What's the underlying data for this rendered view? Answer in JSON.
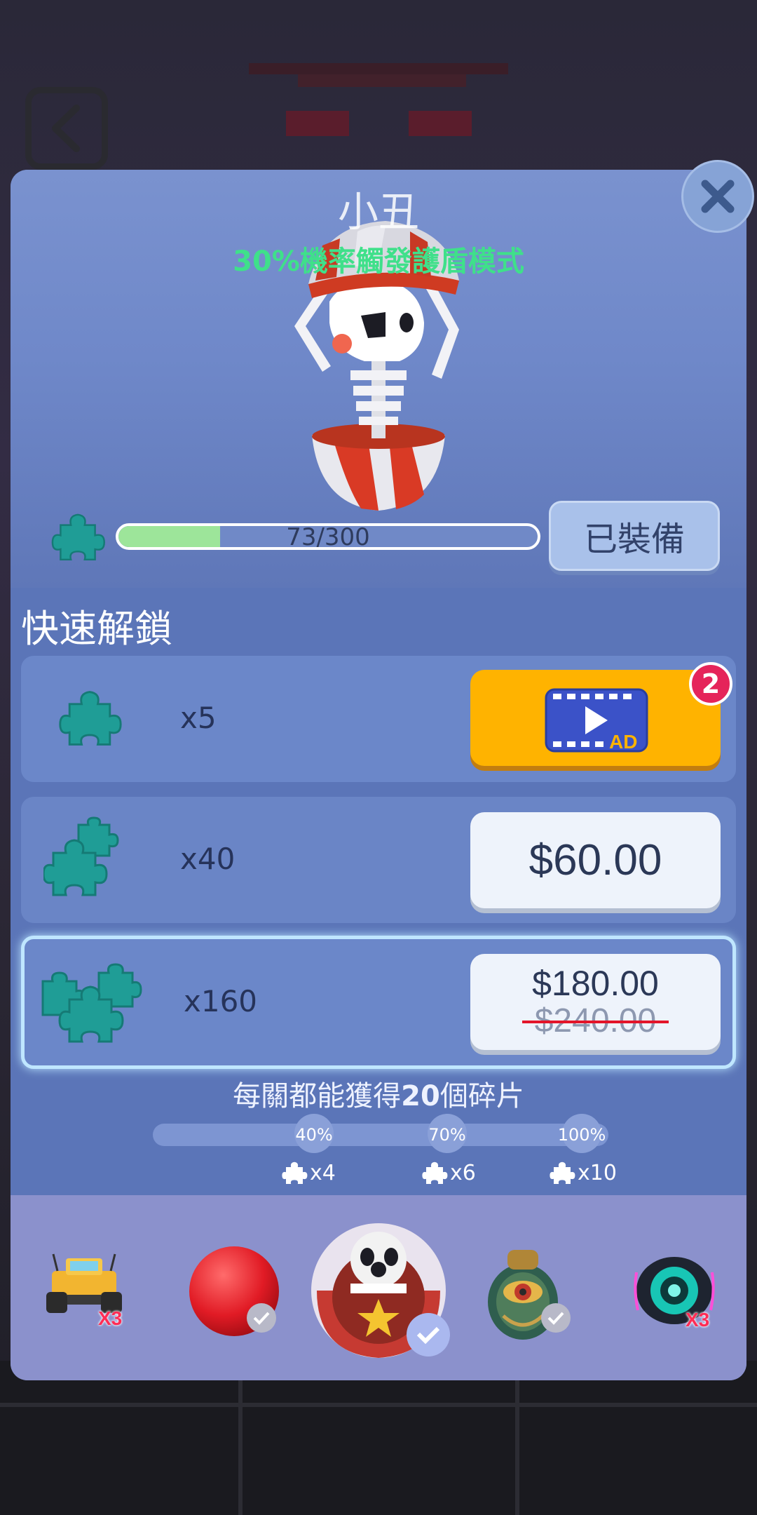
{
  "item": {
    "name": "小丑",
    "description": "30%機率觸發護盾模式"
  },
  "progress": {
    "current": 73,
    "total": 300,
    "text": "73/300",
    "fraction": 0.243
  },
  "equip_button": "已裝備",
  "quick_unlock": {
    "title": "快速解鎖",
    "offers": [
      {
        "quantity": "x5",
        "action": "ad",
        "ad_label": "AD",
        "badge": "2"
      },
      {
        "quantity": "x40",
        "price": "$60.00"
      },
      {
        "quantity": "x160",
        "price": "$180.00",
        "old_price": "$240.00"
      }
    ]
  },
  "level_info": {
    "prefix": "每關都能獲得",
    "count": "20",
    "suffix": "個碎片"
  },
  "milestones": [
    {
      "percent": "40%",
      "reward": "x4"
    },
    {
      "percent": "70%",
      "reward": "x6"
    },
    {
      "percent": "100%",
      "reward": "x10"
    }
  ],
  "skins": [
    {
      "name": "monster-truck",
      "tag": "X3"
    },
    {
      "name": "red-ball",
      "equipped": true
    },
    {
      "name": "clown-ball",
      "selected": true
    },
    {
      "name": "scarab",
      "equipped": true
    },
    {
      "name": "cyber-eye",
      "tag": "X3"
    }
  ],
  "colors": {
    "panel": "#5a73b4",
    "progress_fill": "#9de59a",
    "ad_button": "#ffb300",
    "badge": "#e5245a",
    "subtitle": "#3fe08a",
    "strike": "#e3152a"
  }
}
